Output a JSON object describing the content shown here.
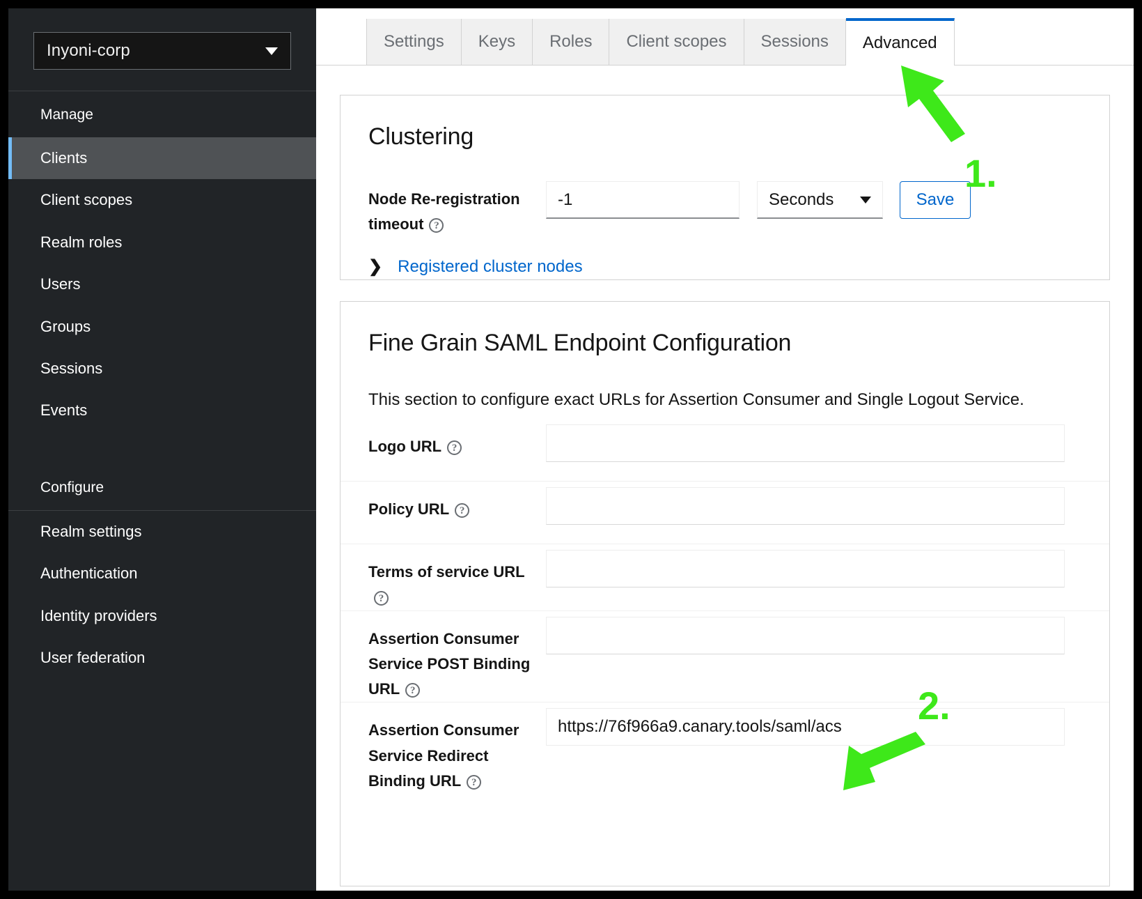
{
  "sidebar": {
    "realm_selector": {
      "value": "Inyoni-corp",
      "icon": "chevron-down-icon"
    },
    "sections": [
      {
        "title": "Manage",
        "items": [
          {
            "label": "Clients",
            "active": true
          },
          {
            "label": "Client scopes",
            "active": false
          },
          {
            "label": "Realm roles",
            "active": false
          },
          {
            "label": "Users",
            "active": false
          },
          {
            "label": "Groups",
            "active": false
          },
          {
            "label": "Sessions",
            "active": false
          },
          {
            "label": "Events",
            "active": false
          }
        ]
      },
      {
        "title": "Configure",
        "items": [
          {
            "label": "Realm settings",
            "active": false
          },
          {
            "label": "Authentication",
            "active": false
          },
          {
            "label": "Identity providers",
            "active": false
          },
          {
            "label": "User federation",
            "active": false
          }
        ]
      }
    ]
  },
  "tabs": [
    {
      "label": "Settings",
      "active": false
    },
    {
      "label": "Keys",
      "active": false
    },
    {
      "label": "Roles",
      "active": false
    },
    {
      "label": "Client scopes",
      "active": false
    },
    {
      "label": "Sessions",
      "active": false
    },
    {
      "label": "Advanced",
      "active": true
    }
  ],
  "clustering": {
    "title": "Clustering",
    "node_timeout_label": "Node Re-registration timeout",
    "node_timeout_value": "-1",
    "node_timeout_help": "?",
    "unit_value": "Seconds",
    "save_label": "Save",
    "registered_nodes_link": "Registered cluster nodes",
    "expand_chevron": "❯"
  },
  "saml": {
    "title": "Fine Grain SAML Endpoint Configuration",
    "description": "This section to configure exact URLs for Assertion Consumer and Single Logout Service.",
    "fields": [
      {
        "label": "Logo URL",
        "help": "?",
        "value": "",
        "placeholder": ""
      },
      {
        "label": "Policy URL",
        "help": "?",
        "value": "",
        "placeholder": ""
      },
      {
        "label": "Terms of service URL",
        "help": "?",
        "value": "",
        "placeholder": ""
      },
      {
        "label": "Assertion Consumer Service POST Binding URL",
        "help": "?",
        "value": "",
        "placeholder": ""
      },
      {
        "label": "Assertion Consumer Service Redirect Binding URL",
        "help": "?",
        "value": "https://76f966a9.canary.tools/saml/acs",
        "placeholder": ""
      }
    ]
  },
  "annotations": [
    {
      "number": "1.",
      "target": "advanced-tab"
    },
    {
      "number": "2.",
      "target": "assertion-consumer-redirect-binding-url-input"
    }
  ],
  "colors": {
    "accent_blue": "#0066cc",
    "sidebar_bg": "#212427",
    "sidebar_active": "#4f5255",
    "sidebar_active_bar": "#73bcf7",
    "annotation_green": "#3ee81a"
  }
}
